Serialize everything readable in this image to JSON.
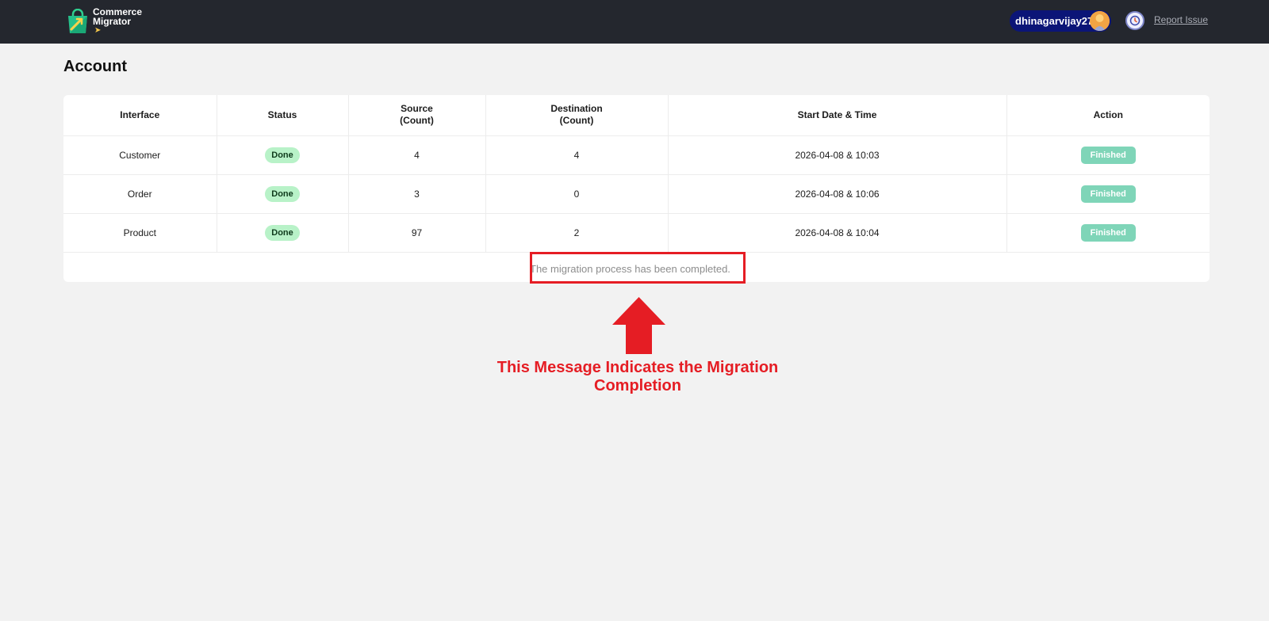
{
  "brand": {
    "line1": "Commerce",
    "line2": "Migrator"
  },
  "header": {
    "username": "dhinagarvijay27",
    "report_label": "Report Issue"
  },
  "page": {
    "title": "Account"
  },
  "table": {
    "headers": [
      "Interface",
      "Status",
      "Source\n(Count)",
      "Destination\n(Count)",
      "Start Date & Time",
      "Action"
    ],
    "rows": [
      {
        "interface": "Customer",
        "status": "Done",
        "source": "4",
        "destination": "4",
        "start": "2026-04-08 & 10:03",
        "action": "Finished"
      },
      {
        "interface": "Order",
        "status": "Done",
        "source": "3",
        "destination": "0",
        "start": "2026-04-08 & 10:06",
        "action": "Finished"
      },
      {
        "interface": "Product",
        "status": "Done",
        "source": "97",
        "destination": "2",
        "start": "2026-04-08 & 10:04",
        "action": "Finished"
      }
    ],
    "footer_message": "The migration process has been completed."
  },
  "annotation": {
    "text": "This Message Indicates the Migration Completion",
    "color": "#e51d24"
  },
  "icons": {
    "logo": "shopping-bag-icon",
    "avatar": "user-avatar-icon",
    "history": "clock-icon",
    "arrow": "arrow-up-icon"
  },
  "colors": {
    "topbar": "#24272e",
    "user_pill": "#0b1577",
    "done_badge": "#b8f2c8",
    "finished_button": "#7fd5b8"
  }
}
